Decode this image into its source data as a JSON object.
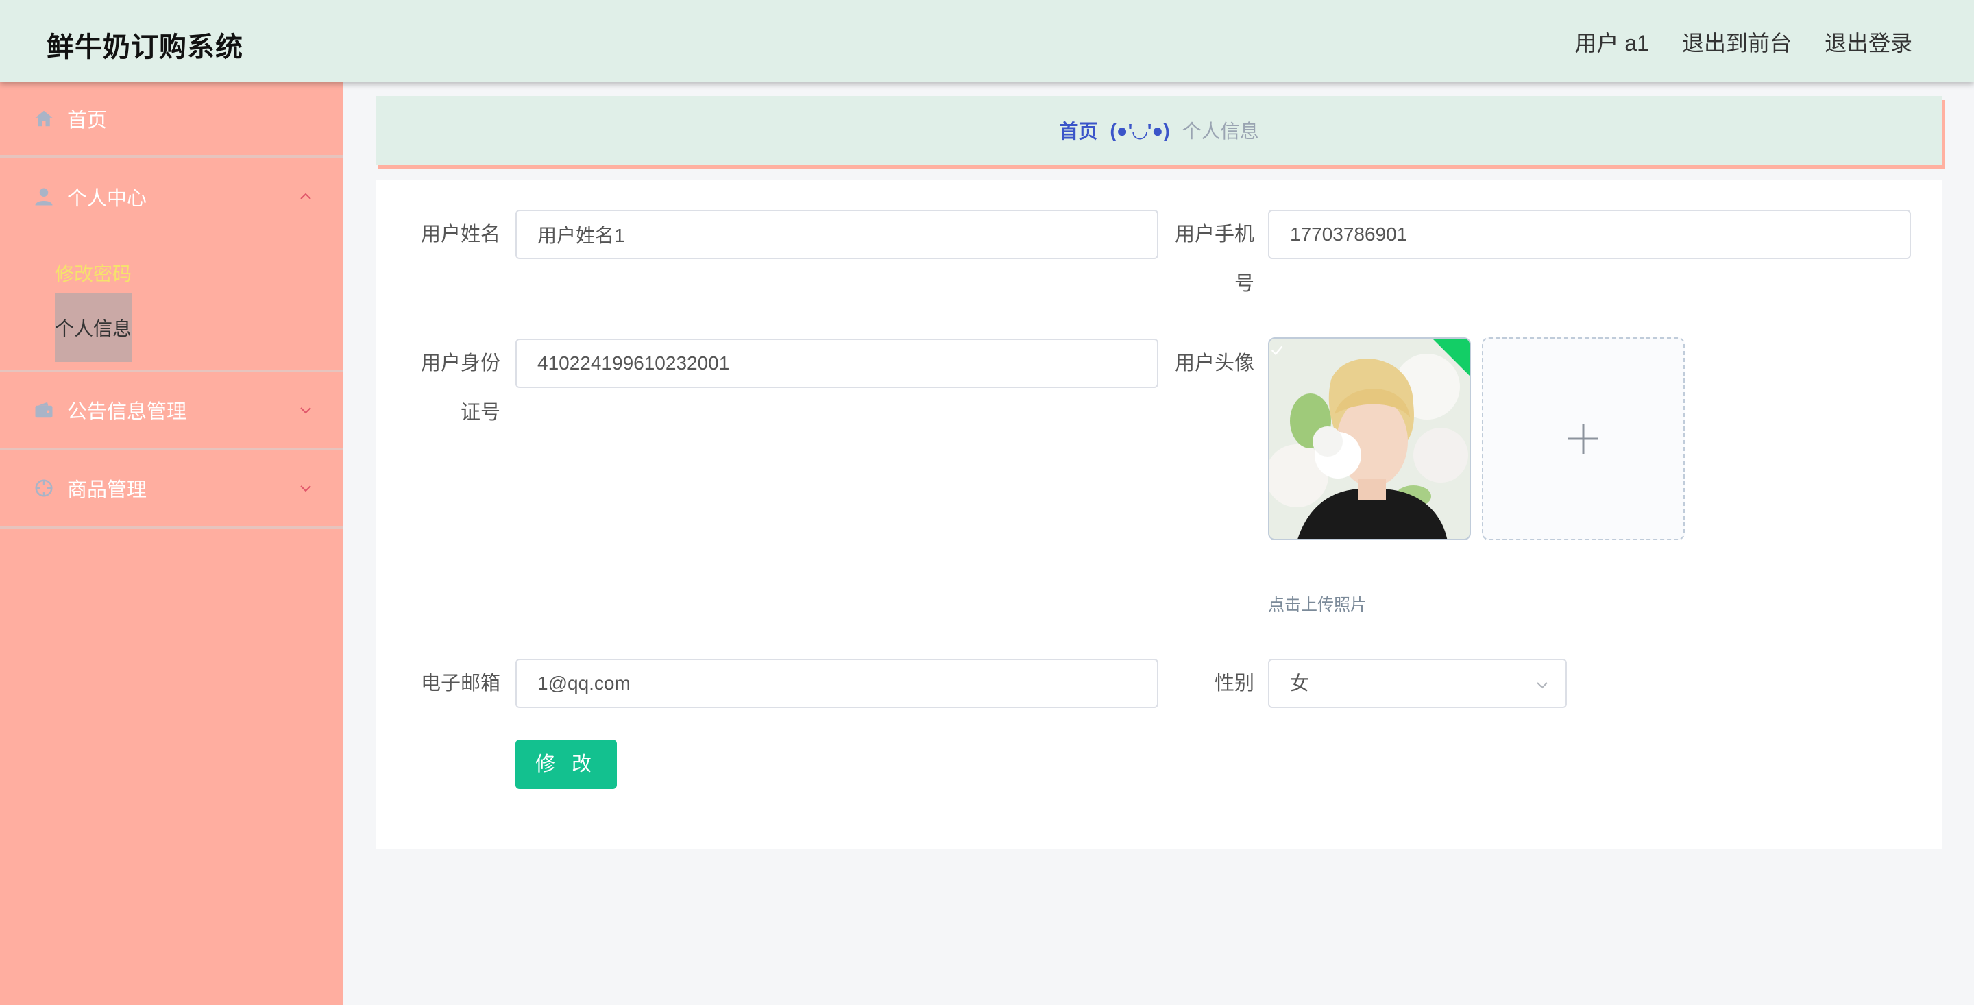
{
  "header": {
    "app_title": "鲜牛奶订购系统",
    "user_label": "用户 a1",
    "to_front_label": "退出到前台",
    "logout_label": "退出登录"
  },
  "sidebar": {
    "home_label": "首页",
    "personal_center_label": "个人中心",
    "change_password_label": "修改密码",
    "personal_info_label": "个人信息",
    "notice_mgmt_label": "公告信息管理",
    "product_mgmt_label": "商品管理"
  },
  "breadcrumb": {
    "home": "首页",
    "separator": "(●'◡'●)",
    "current": "个人信息"
  },
  "form": {
    "name_label": "用户姓名",
    "name_value": "用户姓名1",
    "phone_label": "用户手机号",
    "phone_value": "17703786901",
    "id_label": "用户身份证号",
    "id_value": "410224199610232001",
    "avatar_label": "用户头像",
    "upload_hint": "点击上传照片",
    "email_label": "电子邮箱",
    "email_value": "1@qq.com",
    "gender_label": "性别",
    "gender_value": "女",
    "submit_label": "修 改"
  },
  "colors": {
    "header_bg": "#e0efe8",
    "sidebar_bg": "#ffaea0",
    "active_sub_text": "#f5e36b",
    "breadcrumb_link": "#3b55c9",
    "submit_bg": "#13c18f"
  },
  "icons": {
    "home": "home-icon",
    "user": "user-icon",
    "wallet": "wallet-icon",
    "target": "crosshair-icon",
    "chevron_up": "chevron-up-icon",
    "chevron_down": "chevron-down-icon",
    "plus": "plus-icon",
    "check": "check-icon"
  }
}
